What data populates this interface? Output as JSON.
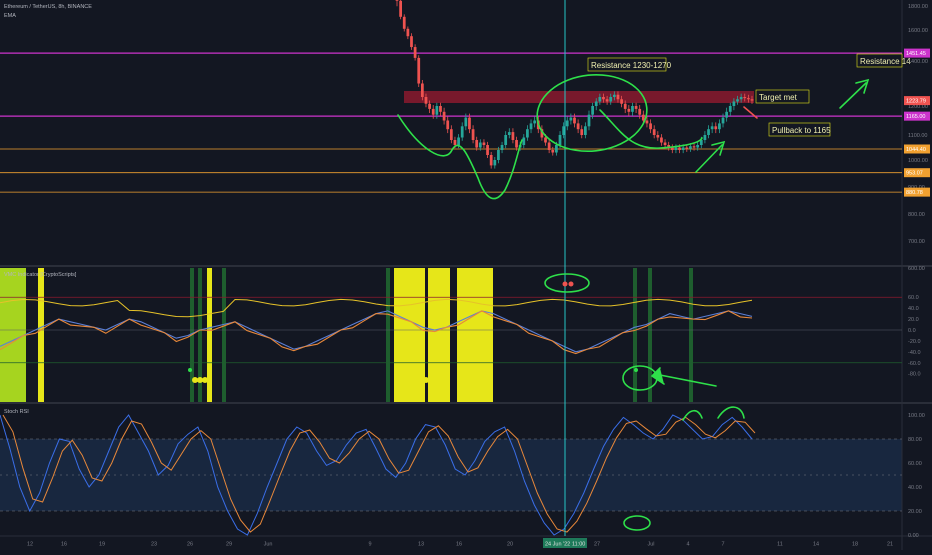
{
  "header": {
    "symbol": "Ethereum / TetherUS, 8h, BINANCE",
    "indicator": "EMA"
  },
  "colors": {
    "background": "#131722",
    "up": "#26a69a",
    "down": "#ef5350",
    "resistance_zone": "#8b1a2e",
    "magenta": "#cc33cc",
    "orange": "#f0a030",
    "annotation": "#2ee04a",
    "cursor": "#26c6c6",
    "yellow_block": "#e6e619",
    "lime_block": "#a6d41f",
    "dark_green_bar": "#1e5e2e",
    "rsi_fill": "#1d3557",
    "stoch_k": "#3a6ee8",
    "stoch_d": "#e8883a"
  },
  "price_axis": {
    "ticks": [
      "1800.00",
      "1600.00",
      "1400.00",
      "1200.00",
      "1100.00",
      "1000.00",
      "900.00",
      "800.00",
      "700.00",
      "600.00"
    ]
  },
  "price_tags": [
    {
      "id": "upper-magenta",
      "label": "1451.45",
      "color": "#cc33cc",
      "price": 1451
    },
    {
      "id": "last-price",
      "label": "1223.79",
      "color": "#ef5350",
      "price": 1224
    },
    {
      "id": "lower-magenta",
      "label": "1165.00",
      "color": "#cc33cc",
      "price": 1165
    },
    {
      "id": "orange-1",
      "label": "1044.40",
      "color": "#f0a030",
      "price": 1044
    },
    {
      "id": "orange-2",
      "label": "953.07",
      "color": "#f0a030",
      "price": 953
    },
    {
      "id": "orange-3",
      "label": "880.78",
      "color": "#f0a030",
      "price": 881
    }
  ],
  "annotations": {
    "resistance": "Resistance 1230-1270",
    "target_met": "Target met",
    "pullback": "Pullback to 1165",
    "resistance_right": "Resistance 14"
  },
  "indicator_panel": {
    "title": "VMC Indicator [CryptoScripts]",
    "ticks": [
      "60.0",
      "40.0",
      "20.0",
      "0.0",
      "-20.0",
      "-40.0",
      "-60.0",
      "-80.0"
    ]
  },
  "stoch_panel": {
    "title": "Stoch RSI",
    "ticks": [
      "100.00",
      "80.00",
      "60.00",
      "40.00",
      "20.00",
      "0.00"
    ]
  },
  "time_axis": {
    "labels": [
      "12",
      "16",
      "19",
      "23",
      "26",
      "29",
      "Jun",
      "9",
      "13",
      "16",
      "20",
      "27",
      "Jul",
      "4",
      "7",
      "11",
      "14",
      "18",
      "21"
    ],
    "cursor_label": "24 Jun '22",
    "cursor_time": "11:00"
  },
  "chart_data": {
    "type": "candlestick",
    "symbol": "ETH/USDT",
    "timeframe": "8h",
    "ylim": [
      600,
      1900
    ],
    "horizontal_levels": [
      1451,
      1165,
      1044,
      953,
      881
    ],
    "resistance_zone": [
      1230,
      1270
    ],
    "candles_close": [
      1820,
      1710,
      1610,
      1560,
      1490,
      1420,
      1300,
      1240,
      1210,
      1190,
      1170,
      1200,
      1180,
      1150,
      1120,
      1080,
      1060,
      1090,
      1130,
      1160,
      1120,
      1080,
      1050,
      1070,
      1060,
      1020,
      980,
      1000,
      1040,
      1060,
      1100,
      1110,
      1080,
      1050,
      1060,
      1090,
      1120,
      1140,
      1150,
      1120,
      1090,
      1070,
      1040,
      1030,
      1060,
      1100,
      1130,
      1150,
      1160,
      1140,
      1120,
      1100,
      1130,
      1170,
      1200,
      1220,
      1240,
      1230,
      1220,
      1240,
      1250,
      1230,
      1210,
      1190,
      1180,
      1200,
      1190,
      1170,
      1150,
      1140,
      1120,
      1100,
      1090,
      1070,
      1060,
      1050,
      1040,
      1050,
      1040,
      1050,
      1045,
      1055,
      1050,
      1060,
      1080,
      1100,
      1120,
      1130,
      1120,
      1140,
      1160,
      1180,
      1200,
      1220,
      1230,
      1240,
      1235,
      1230,
      1224
    ],
    "stoch_rsi_k": [
      100,
      72,
      40,
      20,
      35,
      60,
      80,
      78,
      55,
      40,
      50,
      70,
      90,
      100,
      85,
      70,
      50,
      58,
      76,
      84,
      90,
      70,
      40,
      20,
      5,
      0,
      18,
      40,
      60,
      80,
      90,
      85,
      70,
      58,
      62,
      75,
      85,
      88,
      72,
      55,
      48,
      60,
      80,
      92,
      90,
      75,
      55,
      50,
      62,
      78,
      86,
      90,
      70,
      45,
      25,
      10,
      0,
      5,
      18,
      35,
      55,
      74,
      88,
      98,
      92,
      85,
      80,
      88,
      100,
      96,
      88,
      80,
      82,
      92,
      98,
      90,
      80
    ],
    "vmc_wave": [
      -30,
      -20,
      -10,
      0,
      10,
      20,
      15,
      10,
      5,
      0,
      10,
      20,
      15,
      5,
      -5,
      -15,
      -10,
      0,
      5,
      10,
      15,
      5,
      -5,
      -15,
      -25,
      -35,
      -30,
      -20,
      -10,
      0,
      10,
      20,
      30,
      35,
      25,
      15,
      5,
      0,
      5,
      15,
      25,
      35,
      30,
      20,
      10,
      0,
      -10,
      -20,
      -30,
      -40,
      -35,
      -25,
      -15,
      -5,
      5,
      10,
      20,
      30,
      25,
      20,
      25,
      30,
      35,
      30,
      25
    ]
  }
}
